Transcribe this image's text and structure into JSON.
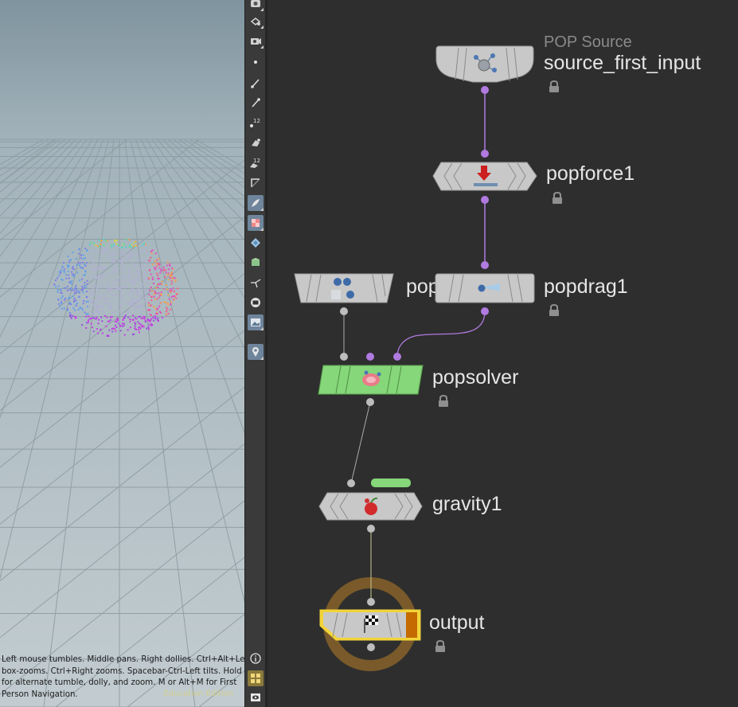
{
  "viewport": {
    "nav_hint_lines": [
      "Left mouse tumbles. Middle pans. Right dollies. Ctrl+Alt+Left",
      "box-zooms. Ctrl+Right zooms. Spacebar-Ctrl-Left tilts. Hold L",
      "for alternate tumble, dolly, and zoom.     M or Alt+M for First",
      "Person Navigation."
    ],
    "edition_label": "Education Edition"
  },
  "toolbar": {
    "tools": [
      {
        "icon": "camera-icon"
      },
      {
        "icon": "select-view-icon"
      },
      {
        "icon": "view-camera-icon"
      },
      {
        "icon": "points-display-icon"
      },
      {
        "icon": "point-normals-icon"
      },
      {
        "icon": "prim-normals-icon"
      },
      {
        "icon": "point-numbers-icon"
      },
      {
        "icon": "vertex-icon"
      },
      {
        "icon": "prim-numbers-icon"
      },
      {
        "icon": "backface-icon"
      },
      {
        "icon": "shading-mode-icon"
      },
      {
        "icon": "texture-icon"
      },
      {
        "icon": "ghost-icon"
      },
      {
        "icon": "lighting-icon"
      },
      {
        "icon": "handles-icon"
      },
      {
        "icon": "safe-area-icon"
      },
      {
        "icon": "background-image-icon"
      },
      {
        "icon": "pin-icon"
      },
      {
        "icon": "info-icon"
      },
      {
        "icon": "layout-icon"
      },
      {
        "icon": "eye-icon"
      }
    ]
  },
  "network": {
    "accent": "#b07ae0",
    "solver_color": "#86d67a",
    "output_ring_color": "#7a5a2a",
    "nodes": {
      "source": {
        "type_label": "POP Source",
        "name": "source_first_input",
        "icon": "emitter-icon"
      },
      "popforce": {
        "name": "popforce1",
        "icon": "force-arrow-icon"
      },
      "popobject": {
        "name": "popobject",
        "icon": "balls-icon"
      },
      "popdrag": {
        "name": "popdrag1",
        "icon": "drag-icon"
      },
      "popsolver": {
        "name": "popsolver",
        "icon": "solver-icon"
      },
      "gravity": {
        "name": "gravity1",
        "icon": "apple-icon"
      },
      "output": {
        "name": "output",
        "icon": "checkered-flag-icon"
      }
    }
  }
}
